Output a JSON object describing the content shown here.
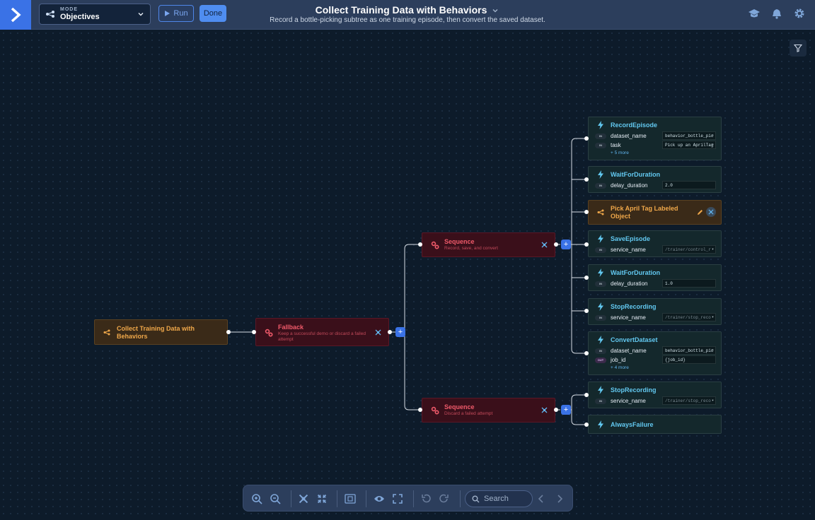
{
  "header": {
    "mode_label": "MODE",
    "mode_value": "Objectives",
    "run_label": "Run",
    "done_label": "Done",
    "title": "Collect Training Data with Behaviors",
    "subtitle": "Record a bottle-picking subtree as one training episode, then convert the saved dataset.",
    "icons": [
      "logo-chevron-icon",
      "tree-icon",
      "chevron-down-icon",
      "play-icon",
      "graduation-cap-icon",
      "bell-icon",
      "gear-icon"
    ]
  },
  "nodes": {
    "root": {
      "title": "Collect Training Data with Behaviors"
    },
    "fallback": {
      "title": "Fallback",
      "desc": "Keep a successful demo or discard a failed attempt"
    },
    "seq1": {
      "title": "Sequence",
      "desc": "Record, save, and convert"
    },
    "seq2": {
      "title": "Sequence",
      "desc": "Discard a failed attempt"
    },
    "record_episode": {
      "title": "RecordEpisode",
      "ports": [
        {
          "dir": "IN",
          "name": "dataset_name",
          "value": "behavior_bottle_pic"
        },
        {
          "dir": "IN",
          "name": "task",
          "value": "Pick up an AprilTag"
        }
      ],
      "more": "+ 5 more"
    },
    "wait1": {
      "title": "WaitForDuration",
      "ports": [
        {
          "dir": "IN",
          "name": "delay_duration",
          "value": "2.0"
        }
      ]
    },
    "pick": {
      "title": "Pick April Tag Labeled Object"
    },
    "save_episode": {
      "title": "SaveEpisode",
      "ports": [
        {
          "dir": "IN",
          "name": "service_name",
          "value": "/trainer/control_r"
        }
      ]
    },
    "wait2": {
      "title": "WaitForDuration",
      "ports": [
        {
          "dir": "IN",
          "name": "delay_duration",
          "value": "1.0"
        }
      ]
    },
    "stop1": {
      "title": "StopRecording",
      "ports": [
        {
          "dir": "IN",
          "name": "service_name",
          "value": "/trainer/stop_reco"
        }
      ]
    },
    "convert": {
      "title": "ConvertDataset",
      "ports": [
        {
          "dir": "IN",
          "name": "dataset_name",
          "value": "behavior_bottle_pic"
        },
        {
          "dir": "OUT",
          "name": "job_id",
          "value": "{job_id}"
        }
      ],
      "more": "+ 4 more"
    },
    "stop2": {
      "title": "StopRecording",
      "ports": [
        {
          "dir": "IN",
          "name": "service_name",
          "value": "/trainer/stop_reco"
        }
      ]
    },
    "always_failure": {
      "title": "AlwaysFailure"
    }
  },
  "toolbar": {
    "search_placeholder": "Search",
    "icons": [
      "zoom-in-icon",
      "zoom-out-icon",
      "expand-icon",
      "collapse-icon",
      "frame-icon",
      "eye-icon",
      "fullscreen-icon",
      "undo-icon",
      "redo-icon",
      "search-icon",
      "prev-icon",
      "next-icon"
    ]
  },
  "colors": {
    "accent": "#3a72e6",
    "subtree": "#f0a84a",
    "control": "#f05a6a",
    "action": "#62c8f0",
    "background": "#0d1b2a"
  }
}
